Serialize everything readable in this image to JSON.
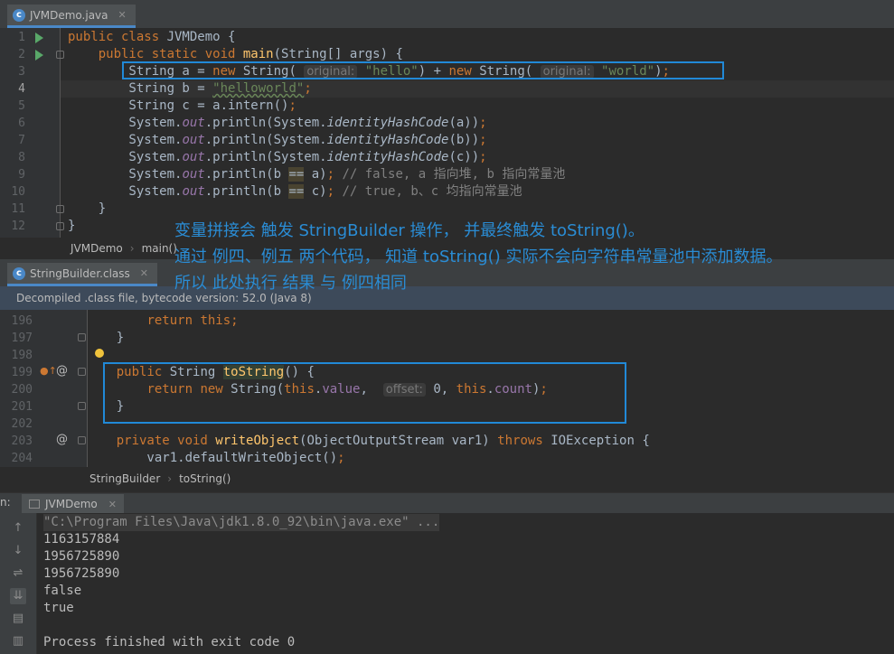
{
  "editor1": {
    "tab_label": "JVMDemo.java",
    "breadcrumb": [
      "JVMDemo",
      "main()"
    ],
    "line_numbers": [
      "1",
      "2",
      "3",
      "4",
      "5",
      "6",
      "7",
      "8",
      "9",
      "10",
      "11",
      "12"
    ]
  },
  "editor2": {
    "tab_label": "StringBuilder.class",
    "banner": "Decompiled .class file, bytecode version: 52.0 (Java 8)",
    "breadcrumb": [
      "StringBuilder",
      "toString()"
    ],
    "line_numbers": [
      "196",
      "197",
      "198",
      "199",
      "200",
      "201",
      "202",
      "203",
      "204"
    ]
  },
  "annotation": {
    "line1": "变量拼接会 触发 StringBuilder 操作， 并最终触发 toString()。",
    "line2": "通过 例四、例五 两个代码， 知道 toString() 实际不会向字符串常量池中添加数据。",
    "line3": "所以 此处执行 结果 与 例四相同"
  },
  "console": {
    "tab_label": "JVMDemo",
    "lines": [
      "\"C:\\Program Files\\Java\\jdk1.8.0_92\\bin\\java.exe\" ...",
      "1163157884",
      "1956725890",
      "1956725890",
      "false",
      "true",
      "",
      "Process finished with exit code 0"
    ]
  },
  "colors": {
    "accent": "#2189d7",
    "annotation": "#2a8cd4",
    "keyword": "#cc7832",
    "string": "#6a8759",
    "field": "#9876aa"
  }
}
